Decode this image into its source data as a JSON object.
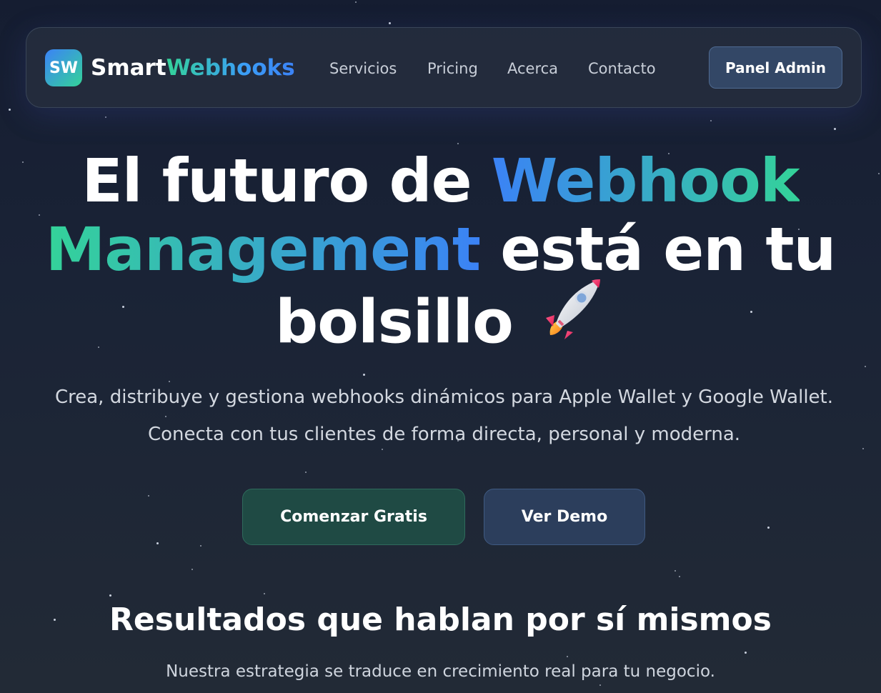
{
  "colors": {
    "background": "#1a2336",
    "accent_blue": "#3b82f6",
    "accent_green": "#34d399",
    "primary_button": "#1f4a44",
    "secondary_button": "#2c3e5c",
    "admin_button": "#334766"
  },
  "nav": {
    "logo_badge": "SW",
    "brand_part1": "Smart",
    "brand_part2": "Webhooks",
    "links": [
      "Servicios",
      "Pricing",
      "Acerca",
      "Contacto"
    ],
    "admin_button": "Panel Admin"
  },
  "hero": {
    "title_line1_plain": "El futuro de ",
    "title_line1_highlight": "Webhook",
    "title_line2_highlight": "Management",
    "title_line2_plain": " está en tu",
    "title_line3_plain": "bolsillo",
    "title_icon": "rocket-icon",
    "subtitle": "Crea, distribuye y gestiona webhooks dinámicos para Apple Wallet y Google Wallet. Conecta con tus clientes de forma directa, personal y moderna.",
    "primary_button": "Comenzar Gratis",
    "secondary_button": "Ver Demo"
  },
  "results": {
    "title": "Resultados que hablan por sí mismos",
    "subtitle": "Nuestra estrategia se traduce en crecimiento real para tu negocio."
  }
}
